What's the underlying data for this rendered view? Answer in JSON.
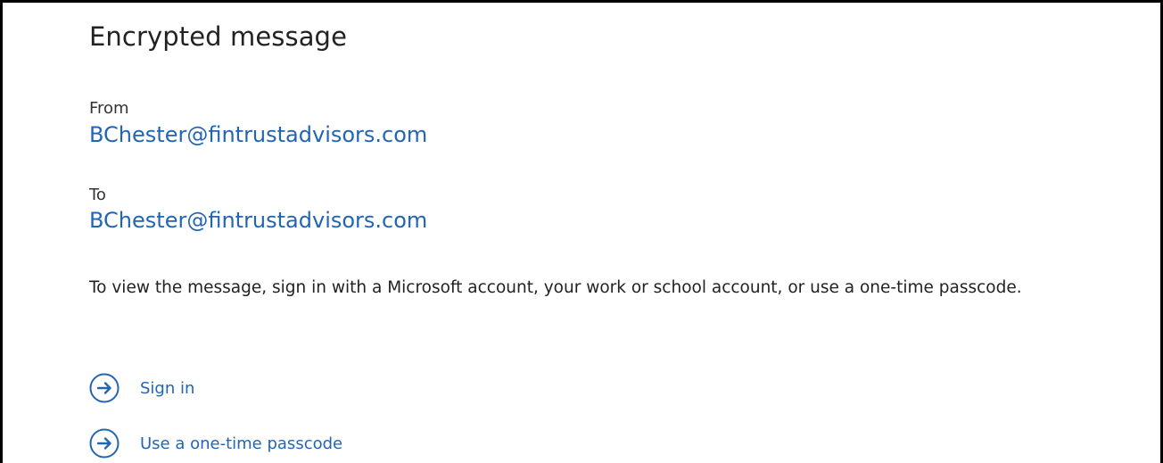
{
  "message": {
    "title": "Encrypted message",
    "from_label": "From",
    "from_address": "BChester@fintrustadvisors.com",
    "to_label": "To",
    "to_address": "BChester@fintrustadvisors.com",
    "instructions": "To view the message, sign in with a Microsoft account, your work or school account, or use a one-time passcode."
  },
  "actions": [
    {
      "label": "Sign in",
      "icon": "arrow-right-circle-icon"
    },
    {
      "label": "Use a one-time passcode",
      "icon": "arrow-right-circle-icon"
    }
  ],
  "colors": {
    "link": "#2266b3",
    "text": "#222222",
    "border": "#000000"
  }
}
